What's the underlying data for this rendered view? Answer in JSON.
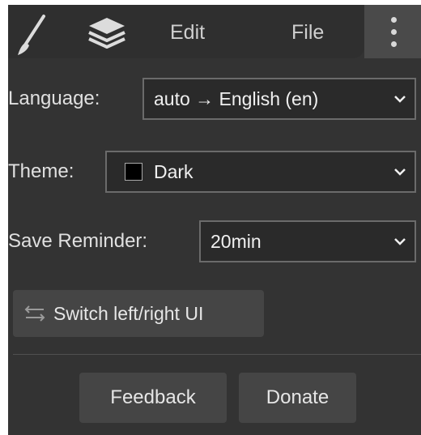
{
  "tabs": {
    "brush_icon": "brush-icon",
    "layers_icon": "layers-icon",
    "edit_label": "Edit",
    "file_label": "File",
    "more_icon": "more-vertical-icon"
  },
  "settings": {
    "language": {
      "label": "Language:",
      "value": "auto → English (en)"
    },
    "theme": {
      "label": "Theme:",
      "value": "Dark",
      "swatch_color": "#000000"
    },
    "save_reminder": {
      "label": "Save Reminder:",
      "value": "20min"
    }
  },
  "actions": {
    "switch_ui_label": "Switch left/right UI",
    "switch_icon": "swap-arrows-icon",
    "feedback_label": "Feedback",
    "donate_label": "Donate"
  },
  "colors": {
    "panel_bg": "#333333",
    "tab_strip_bg": "#2f2f2f",
    "active_tab_bg": "#4a4a4a",
    "select_bg": "#2a2a2a",
    "button_bg": "#454545"
  }
}
